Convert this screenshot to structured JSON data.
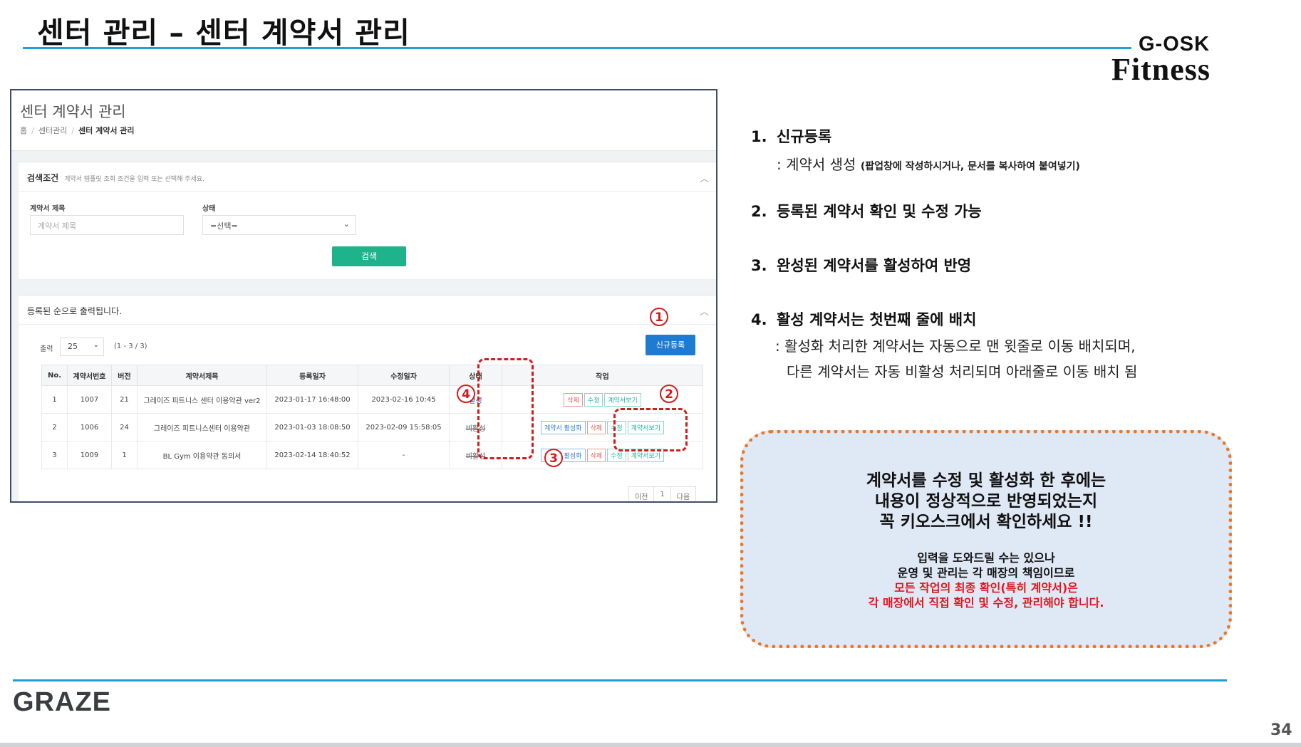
{
  "slide": {
    "title": "센터 관리 – 센터 계약서 관리",
    "brand_top": "G-OSK",
    "brand_bottom": "Fitness",
    "logo": "GRAZE",
    "page_number": "34"
  },
  "screen": {
    "title": "센터 계약서 관리",
    "breadcrumb": [
      "홈",
      "센터관리",
      "센터 계약서 관리"
    ],
    "search_card": {
      "title": "검색조건",
      "desc": "계약서 템플릿 조회 조건을 입력 또는 선택해 주세요.",
      "field_title_label": "계약서 제목",
      "field_title_placeholder": "계약서 제목",
      "field_status_label": "상태",
      "field_status_value": "=선택=",
      "search_button": "검색"
    },
    "list_card": {
      "title": "등록된 순으로 출력됩니다.",
      "per_page_label": "출력",
      "per_page_value": "25",
      "count": "(1 - 3 / 3)",
      "new_button": "신규등록",
      "columns": [
        "No.",
        "계약서번호",
        "버전",
        "계약서제목",
        "등록일자",
        "수정일자",
        "상태",
        "작업"
      ],
      "rows": [
        {
          "no": "1",
          "contract_no": "1007",
          "version": "21",
          "title": "그레이즈 피트니스 센터 이용약관 ver2",
          "created": "2023-01-17 16:48:00",
          "modified": "2023-02-16 10:45",
          "status": "활성"
        },
        {
          "no": "2",
          "contract_no": "1006",
          "version": "24",
          "title": "그레이즈 피트니스센터 이용약관",
          "created": "2023-01-03 18:08:50",
          "modified": "2023-02-09 15:58:05",
          "status": "비활성"
        },
        {
          "no": "3",
          "contract_no": "1009",
          "version": "1",
          "title": "BL Gym 이용약관 동의서",
          "created": "2023-02-14 18:40:52",
          "modified": "-",
          "status": "비활성"
        }
      ],
      "actions": {
        "activate": "계약서 활성화",
        "delete": "삭제",
        "edit": "수정",
        "view": "계약서보기"
      },
      "pager": {
        "prev": "이전",
        "page": "1",
        "next": "다음"
      }
    },
    "annotations": [
      "1",
      "2",
      "3",
      "4"
    ]
  },
  "steps": [
    {
      "num": "1.",
      "title": "신규등록"
    },
    {
      "num": "2.",
      "title": "등록된 계약서 확인 및 수정 가능"
    },
    {
      "num": "3.",
      "title": "완성된 계약서를 활성하여 반영"
    },
    {
      "num": "4.",
      "title": "활성 계약서는 첫번째 줄에 배치"
    }
  ],
  "step1_sub": ": 계약서 생성",
  "step1_sub_small": "(팝업창에 작성하시거나, 문서를 복사하여 붙여넣기)",
  "step4_sub1": ": 활성화 처리한 계약서는 자동으로 맨 윗줄로 이동 배치되며,",
  "step4_sub2": "다른 계약서는 자동 비활성 처리되며 아래줄로 이동 배치 됨",
  "note": {
    "line1": "계약서를 수정 및 활성화 한 후에는",
    "line2": "내용이 정상적으로 반영되었는지",
    "line3": "꼭 키오스크에서 확인하세요 !!",
    "sub1": "입력을 도와드릴 수는 있으나",
    "sub2": "운영 및 관리는 각 매장의 책임이므로",
    "red1": "모든 작업의 최종 확인(특히 계약서)은",
    "red2": "각 매장에서 직접 확인 및 수정, 관리해야 합니다."
  }
}
